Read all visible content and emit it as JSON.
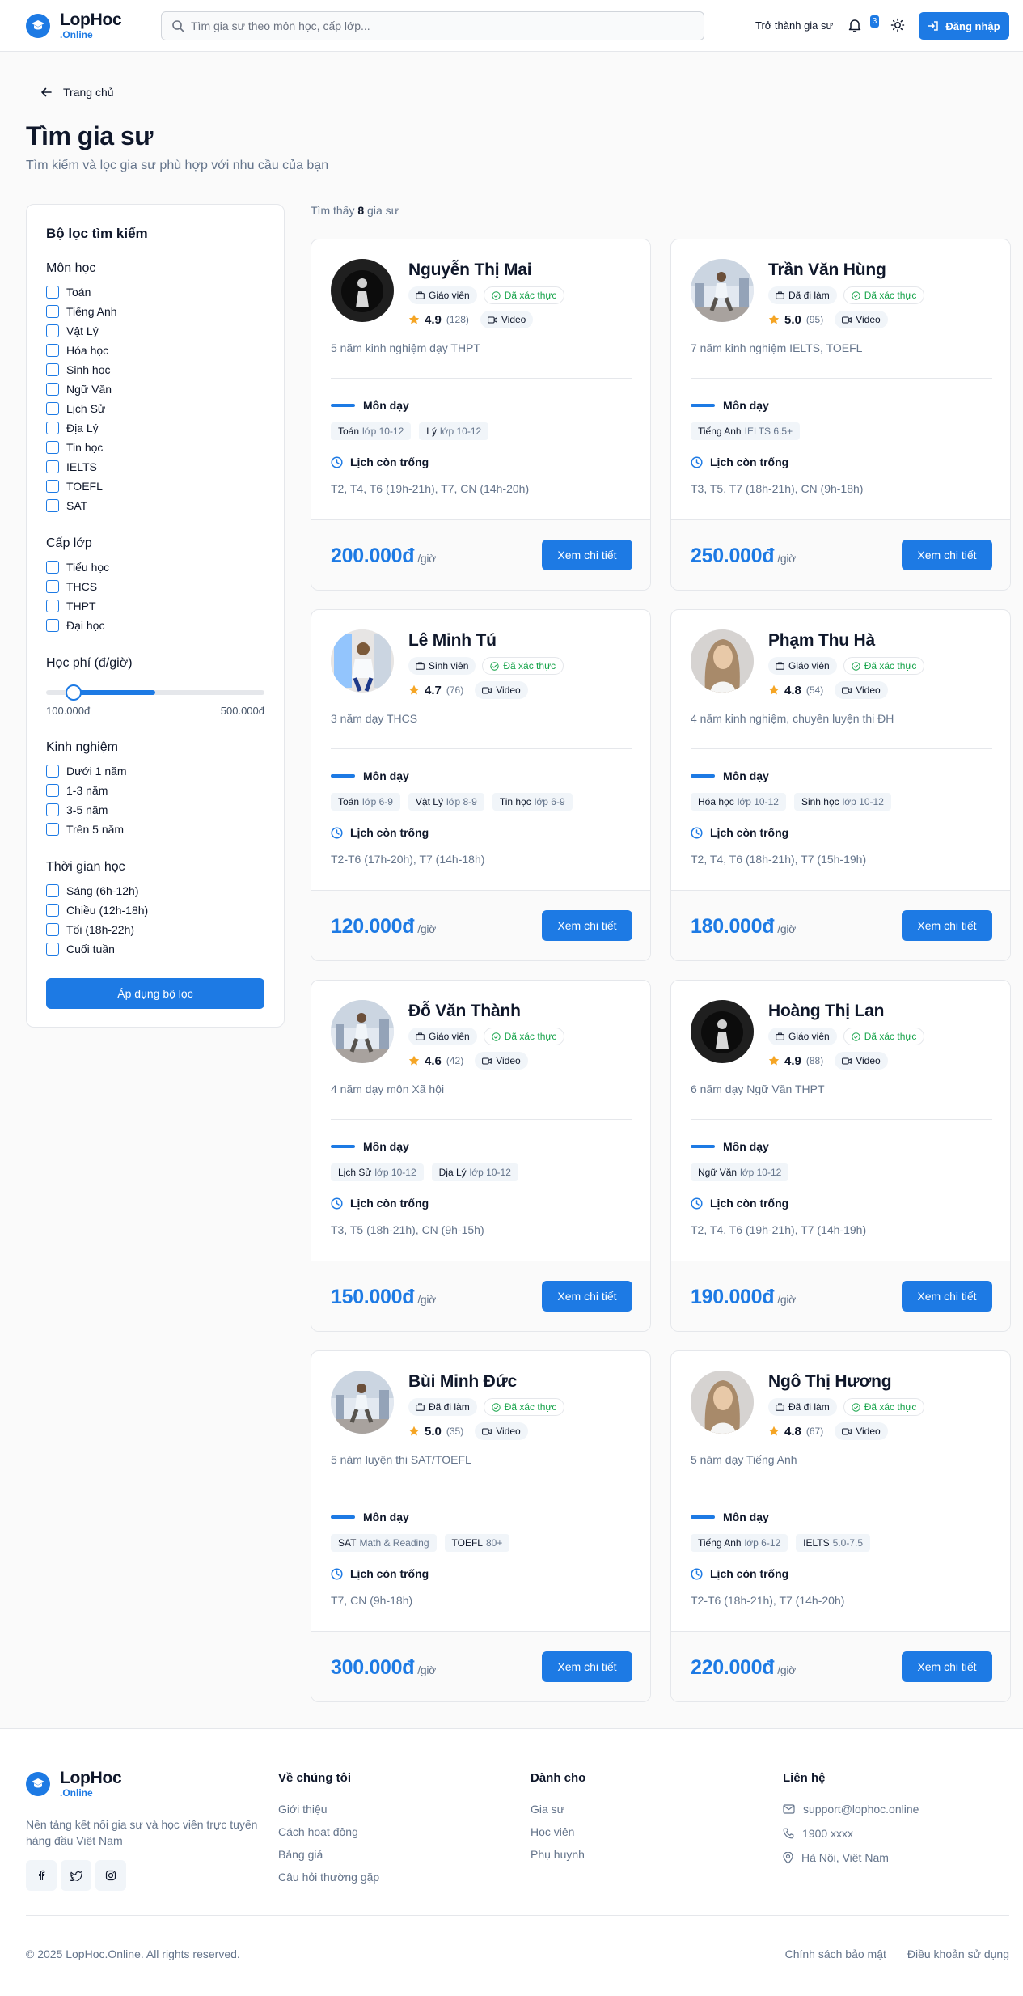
{
  "brand": {
    "name": "LopHoc",
    "suffix": ".Online",
    "accent": "#1d7ae4"
  },
  "header": {
    "search_placeholder": "Tìm gia sư theo môn học, cấp lớp...",
    "become_tutor": "Trở thành gia sư",
    "notif_count": "3",
    "login": "Đăng nhập"
  },
  "page": {
    "back": "Trang chủ",
    "title": "Tìm gia sư",
    "subtitle": "Tìm kiếm và lọc gia sư phù hợp với nhu cầu của bạn"
  },
  "filters": {
    "title": "Bộ lọc tìm kiếm",
    "subjects_title": "Môn học",
    "subjects": [
      "Toán",
      "Tiếng Anh",
      "Vật Lý",
      "Hóa học",
      "Sinh học",
      "Ngữ Văn",
      "Lịch Sử",
      "Địa Lý",
      "Tin học",
      "IELTS",
      "TOEFL",
      "SAT"
    ],
    "levels_title": "Cấp lớp",
    "levels": [
      "Tiểu học",
      "THCS",
      "THPT",
      "Đại học"
    ],
    "fee_title": "Học phí (đ/giờ)",
    "fee_min": "100.000đ",
    "fee_max": "500.000đ",
    "fee_range": {
      "min": 100000,
      "max": 500000,
      "low": 150000,
      "high": 300000
    },
    "exp_title": "Kinh nghiệm",
    "experience": [
      "Dưới 1 năm",
      "1-3 năm",
      "3-5 năm",
      "Trên 5 năm"
    ],
    "time_title": "Thời gian học",
    "times": [
      "Sáng (6h-12h)",
      "Chiều (12h-18h)",
      "Tối (18h-22h)",
      "Cuối tuần"
    ],
    "apply": "Áp dụng bộ lọc"
  },
  "results": {
    "prefix": "Tìm thấy",
    "count": "8",
    "suffix": "gia sư"
  },
  "labels": {
    "verified": "Đã xác thực",
    "video": "Video",
    "subjects": "Môn dạy",
    "schedule": "Lịch còn trống",
    "unit": "/giờ",
    "detail": "Xem chi tiết"
  },
  "tutors": [
    {
      "name": "Nguyễn Thị Mai",
      "role": "Giáo viên",
      "rating": "4.9",
      "reviews": "(128)",
      "desc": "5 năm kinh nghiệm dạy THPT",
      "subjects": [
        {
          "s": "Toán",
          "l": "lớp 10-12"
        },
        {
          "s": "Lý",
          "l": "lớp 10-12"
        }
      ],
      "schedule": "T2, T4, T6 (19h-21h), T7, CN (14h-20h)",
      "price": "200.000đ",
      "avatar": "dark"
    },
    {
      "name": "Trần Văn Hùng",
      "role": "Đã đi làm",
      "rating": "5.0",
      "reviews": "(95)",
      "desc": "7 năm kinh nghiệm IELTS, TOEFL",
      "subjects": [
        {
          "s": "Tiếng Anh",
          "l": "IELTS 6.5+"
        }
      ],
      "schedule": "T3, T5, T7 (18h-21h), CN (9h-18h)",
      "price": "250.000đ",
      "avatar": "street"
    },
    {
      "name": "Lê Minh Tú",
      "role": "Sinh viên",
      "rating": "4.7",
      "reviews": "(76)",
      "desc": "3 năm dạy THCS",
      "subjects": [
        {
          "s": "Toán",
          "l": "lớp 6-9"
        },
        {
          "s": "Vật Lý",
          "l": "lớp 8-9"
        },
        {
          "s": "Tin học",
          "l": "lớp 6-9"
        }
      ],
      "schedule": "T2-T6 (17h-20h), T7 (14h-18h)",
      "price": "120.000đ",
      "avatar": "kid"
    },
    {
      "name": "Phạm Thu Hà",
      "role": "Giáo viên",
      "rating": "4.8",
      "reviews": "(54)",
      "desc": "4 năm kinh nghiệm, chuyên luyện thi ĐH",
      "subjects": [
        {
          "s": "Hóa học",
          "l": "lớp 10-12"
        },
        {
          "s": "Sinh học",
          "l": "lớp 10-12"
        }
      ],
      "schedule": "T2, T4, T6 (18h-21h), T7 (15h-19h)",
      "price": "180.000đ",
      "avatar": "woman"
    },
    {
      "name": "Đỗ Văn Thành",
      "role": "Giáo viên",
      "rating": "4.6",
      "reviews": "(42)",
      "desc": "4 năm dạy môn Xã hội",
      "subjects": [
        {
          "s": "Lịch Sử",
          "l": "lớp 10-12"
        },
        {
          "s": "Địa Lý",
          "l": "lớp 10-12"
        }
      ],
      "schedule": "T3, T5 (18h-21h), CN (9h-15h)",
      "price": "150.000đ",
      "avatar": "street"
    },
    {
      "name": "Hoàng Thị Lan",
      "role": "Giáo viên",
      "rating": "4.9",
      "reviews": "(88)",
      "desc": "6 năm dạy Ngữ Văn THPT",
      "subjects": [
        {
          "s": "Ngữ Văn",
          "l": "lớp 10-12"
        }
      ],
      "schedule": "T2, T4, T6 (19h-21h), T7 (14h-19h)",
      "price": "190.000đ",
      "avatar": "dark"
    },
    {
      "name": "Bùi Minh Đức",
      "role": "Đã đi làm",
      "rating": "5.0",
      "reviews": "(35)",
      "desc": "5 năm luyện thi SAT/TOEFL",
      "subjects": [
        {
          "s": "SAT",
          "l": "Math & Reading"
        },
        {
          "s": "TOEFL",
          "l": "80+"
        }
      ],
      "schedule": "T7, CN (9h-18h)",
      "price": "300.000đ",
      "avatar": "street"
    },
    {
      "name": "Ngô Thị Hương",
      "role": "Đã đi làm",
      "rating": "4.8",
      "reviews": "(67)",
      "desc": "5 năm dạy Tiếng Anh",
      "subjects": [
        {
          "s": "Tiếng Anh",
          "l": "lớp 6-12"
        },
        {
          "s": "IELTS",
          "l": "5.0-7.5"
        }
      ],
      "schedule": "T2-T6 (18h-21h), T7 (14h-20h)",
      "price": "220.000đ",
      "avatar": "woman"
    }
  ],
  "footer": {
    "about": "Nền tảng kết nối gia sư và học viên trực tuyến hàng đầu Việt Nam",
    "col1_title": "Về chúng tôi",
    "col1": [
      "Giới thiệu",
      "Cách hoạt động",
      "Bảng giá",
      "Câu hỏi thường gặp"
    ],
    "col2_title": "Dành cho",
    "col2": [
      "Gia sư",
      "Học viên",
      "Phụ huynh"
    ],
    "col3_title": "Liên hệ",
    "email": "support@lophoc.online",
    "phone": "1900 xxxx",
    "address": "Hà Nội, Việt Nam",
    "copyright": "© 2025 LopHoc.Online. All rights reserved.",
    "privacy": "Chính sách bảo mật",
    "terms": "Điều khoản sử dụng"
  }
}
